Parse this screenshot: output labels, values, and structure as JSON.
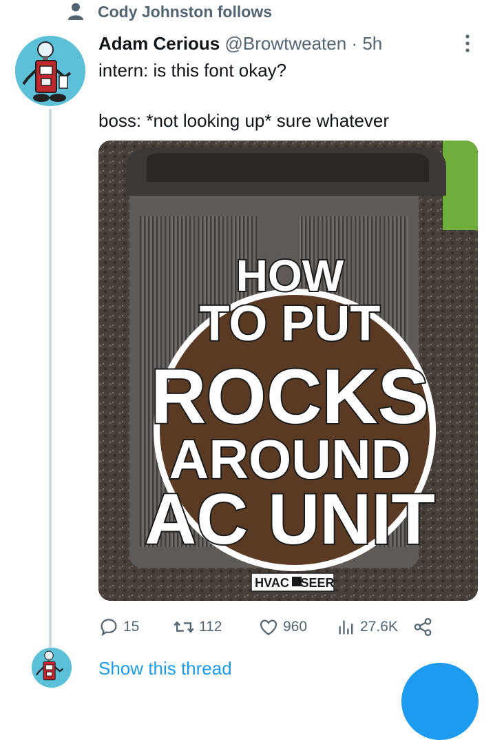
{
  "social_context": {
    "text": "Cody Johnston follows",
    "icon": "person-icon"
  },
  "tweet": {
    "author_name": "Adam Cerious",
    "author_handle": "@Browtweaten",
    "separator": "·",
    "time": "5h",
    "text_lines": [
      "intern: is this font okay?",
      "boss: *not looking up* sure whatever"
    ],
    "media": {
      "headline": [
        "HOW",
        "TO PUT",
        "ROCKS",
        "AROUND",
        "AC UNIT"
      ],
      "watermark_left": "HVAC",
      "watermark_right": "SEER"
    },
    "actions": {
      "replies": "15",
      "retweets": "112",
      "likes": "960",
      "views": "27.6K"
    },
    "show_thread_label": "Show this thread"
  },
  "colors": {
    "accent": "#1d9bf0",
    "secondary_text": "#536471",
    "thread_line": "#cfd9de"
  }
}
